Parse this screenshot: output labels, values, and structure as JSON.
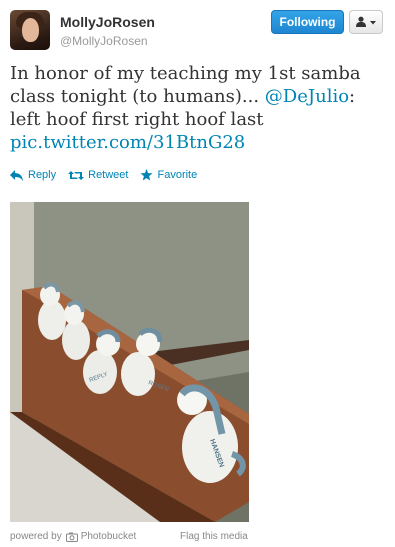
{
  "user": {
    "display_name": "MollyJoRosen",
    "screen_name": "@MollyJoRosen",
    "follow_button": "Following"
  },
  "tweet": {
    "text_before": "In honor of my teaching my 1st samba class tonight (to humans)... ",
    "mention": "@DeJulio",
    "text_after": ": left hoof first right hoof last",
    "link": "pic.twitter.com/31BtnG28"
  },
  "actions": {
    "reply": "Reply",
    "retweet": "Retweet",
    "favorite": "Favorite"
  },
  "media": {
    "powered_by": "powered by",
    "provider": "Photobucket",
    "flag": "Flag this media",
    "figure_label_front": "HANSEN",
    "figure_label_2": "REPLY",
    "figure_label_3": "ROSEN"
  },
  "colors": {
    "link": "#0084b4",
    "follow_button": "#1f86d2",
    "text": "#333333",
    "muted": "#999999"
  }
}
